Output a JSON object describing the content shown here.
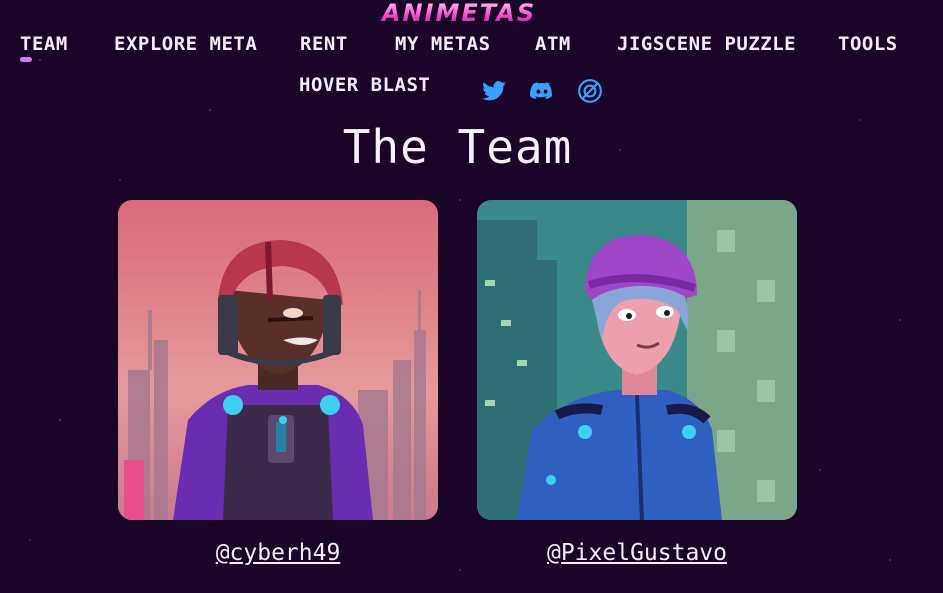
{
  "brand": {
    "logo_text": "ANIMETAS"
  },
  "nav": {
    "items": [
      {
        "label": "TEAM",
        "active": true
      },
      {
        "label": "EXPLORE META"
      },
      {
        "label": "RENT"
      },
      {
        "label": "MY METAS"
      },
      {
        "label": "ATM"
      },
      {
        "label": "JIGSCENE PUZZLE"
      },
      {
        "label": "TOOLS"
      },
      {
        "label": "HOVER BLAST"
      }
    ],
    "social": [
      "twitter-icon",
      "discord-icon",
      "opensea-icon"
    ]
  },
  "page": {
    "title": "The Team"
  },
  "team": [
    {
      "handle": "@cyberh49"
    },
    {
      "handle": "@PixelGustavo"
    }
  ],
  "colors": {
    "background": "#1a0428",
    "accent": "#c77ef0",
    "social_icon": "#3aa0ff",
    "logo": "#ff4fd0"
  }
}
